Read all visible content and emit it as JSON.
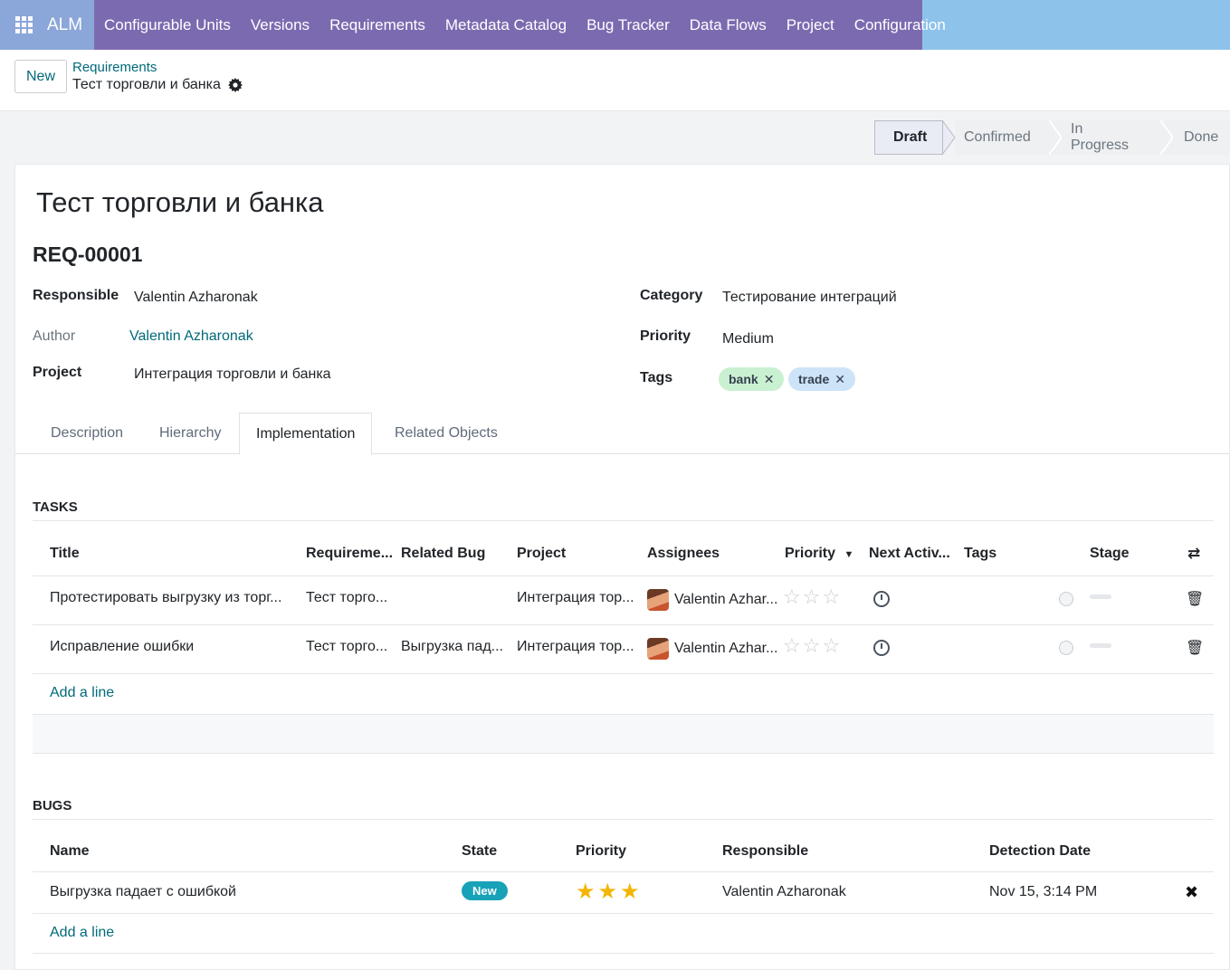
{
  "app": {
    "name": "ALM"
  },
  "nav": {
    "items": [
      "Configurable Units",
      "Versions",
      "Requirements",
      "Metadata Catalog",
      "Bug Tracker",
      "Data Flows",
      "Project",
      "Configuration"
    ]
  },
  "control": {
    "new_label": "New",
    "breadcrumb_parent": "Requirements",
    "breadcrumb_current": "Тест торговли и банка"
  },
  "status": {
    "stages": [
      "Draft",
      "Confirmed",
      "In Progress",
      "Done"
    ],
    "active": "Draft"
  },
  "record": {
    "title": "Тест торговли и банка",
    "reference": "REQ-00001",
    "fields": {
      "responsible_label": "Responsible",
      "responsible_value": "Valentin Azharonak",
      "author_label": "Author",
      "author_value": "Valentin Azharonak",
      "project_label": "Project",
      "project_value": "Интеграция торговли и банка",
      "category_label": "Category",
      "category_value": "Тестирование интеграций",
      "priority_label": "Priority",
      "priority_value": "Medium",
      "tags_label": "Tags"
    },
    "tags": [
      {
        "label": "bank",
        "color": "#c9f0d1"
      },
      {
        "label": "trade",
        "color": "#cde3f7"
      }
    ]
  },
  "tabs": [
    "Description",
    "Hierarchy",
    "Implementation",
    "Related Objects"
  ],
  "tasks": {
    "heading": "TASKS",
    "columns": [
      "Title",
      "Requireme...",
      "Related Bug",
      "Project",
      "Assignees",
      "Priority",
      "Next Activ...",
      "Tags",
      "Stage"
    ],
    "rows": [
      {
        "title": "Протестировать выгрузку из торг...",
        "requirement": "Тест торго...",
        "related_bug": "",
        "project": "Интеграция тор...",
        "assignee": "Valentin Azhar...",
        "priority_stars": 0
      },
      {
        "title": "Исправление ошибки",
        "requirement": "Тест торго...",
        "related_bug": "Выгрузка пад...",
        "project": "Интеграция тор...",
        "assignee": "Valentin Azhar...",
        "priority_stars": 0
      }
    ],
    "add_line": "Add a line"
  },
  "bugs": {
    "heading": "BUGS",
    "columns": [
      "Name",
      "State",
      "Priority",
      "Responsible",
      "Detection Date"
    ],
    "rows": [
      {
        "name": "Выгрузка падает с ошибкой",
        "state": "New",
        "priority_stars": 3,
        "responsible": "Valentin Azharonak",
        "detection_date": "Nov 15, 3:14 PM"
      }
    ],
    "add_line": "Add a line"
  },
  "icons": {
    "apps": "apps-grid-icon",
    "gear": "gear-icon",
    "trash": "trash-icon",
    "close": "close-icon",
    "clock": "clock-icon",
    "sort": "caret-down-icon",
    "columns": "column-toggle-icon"
  },
  "colors": {
    "nav_purple": "#7c6ab0",
    "nav_blue": "#8dc3ea",
    "link": "#016a7a",
    "badge": "#17a2b8",
    "star": "#f3b603"
  }
}
